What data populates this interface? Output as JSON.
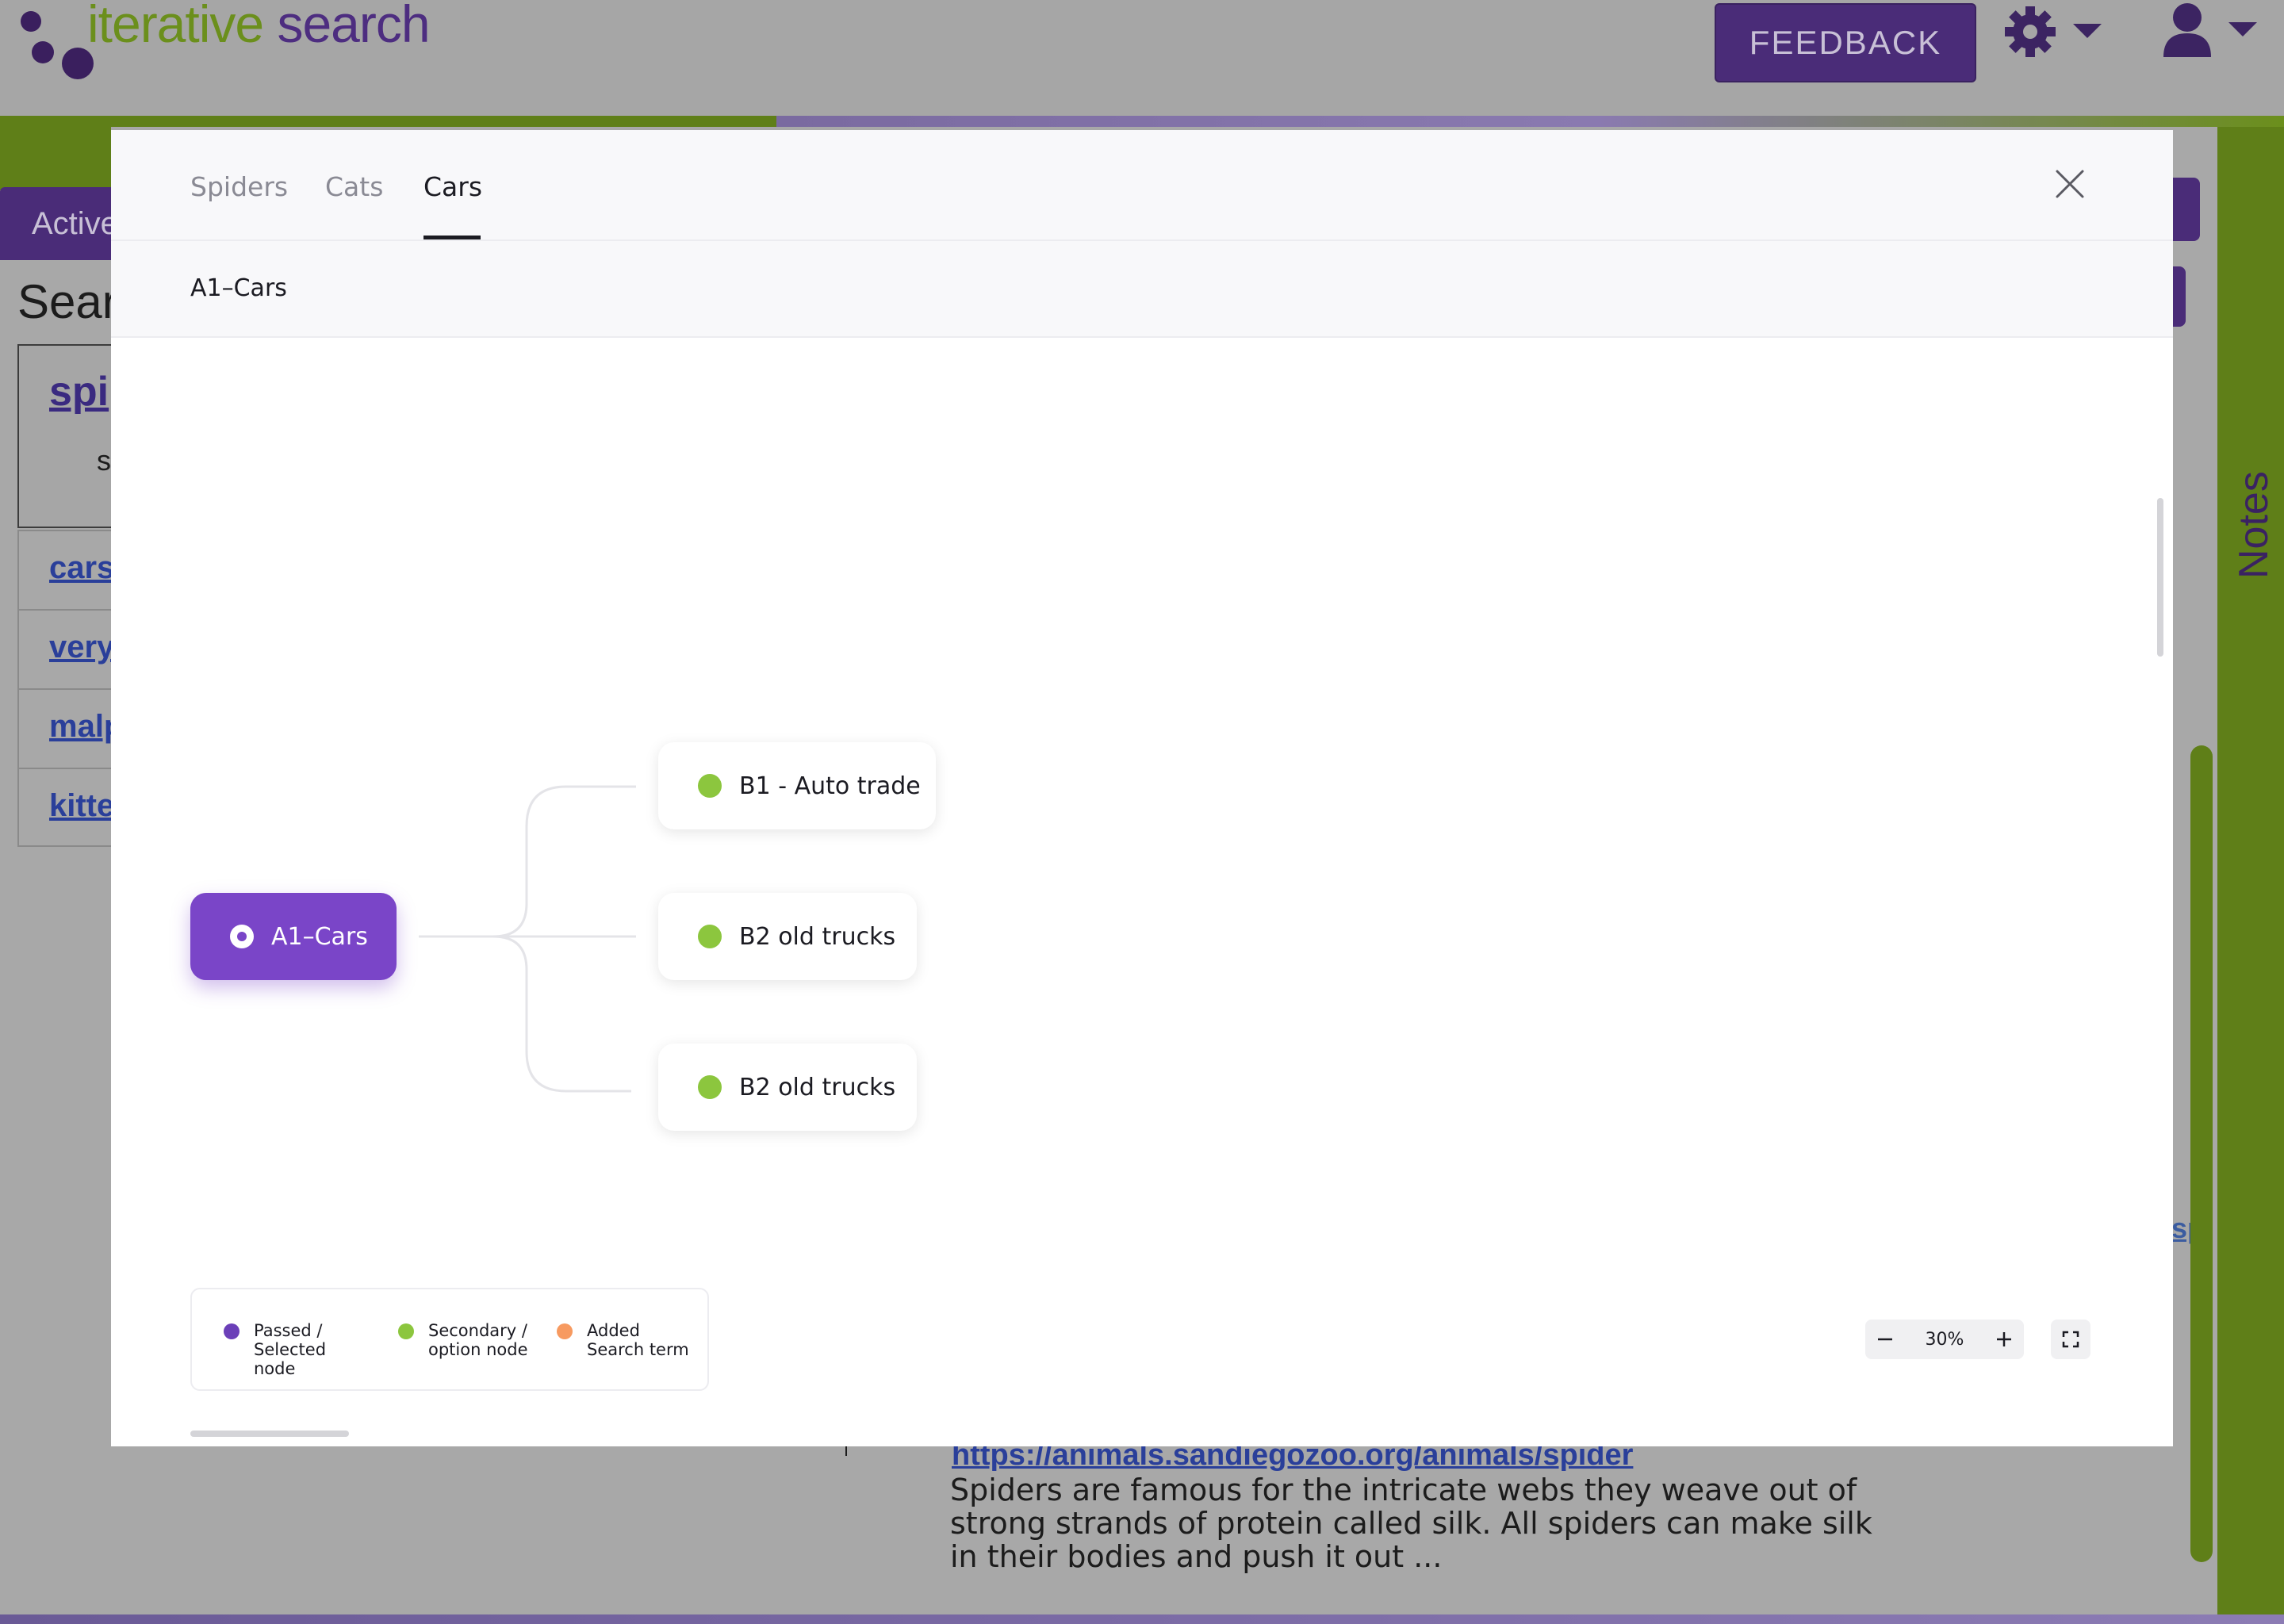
{
  "app": {
    "logo_prefix": "iterative",
    "logo_suffix": " search",
    "feedback_label": "FEEDBACK",
    "notes_label": "Notes",
    "active_tab_label": "Active",
    "search_heading": "Sear",
    "card_link": "spi",
    "card_text": "s",
    "list_items": [
      "cars",
      "very",
      "malp",
      "kitte"
    ],
    "right_link_fragment": "sp",
    "result_url": "https://animals.sandiegozoo.org/animals/spider",
    "result_snippet": "Spiders are famous for the intricate webs they weave out of strong strands of protein called silk. All spiders can make silk in their bodies and push it out ..."
  },
  "modal": {
    "tabs": [
      {
        "label": "Spiders",
        "active": false
      },
      {
        "label": "Cats",
        "active": false
      },
      {
        "label": "Cars",
        "active": true
      }
    ],
    "breadcrumb": "A1–Cars",
    "root_node": {
      "label": "A1–Cars",
      "color": "#7a45c8"
    },
    "child_nodes": [
      {
        "label": "B1 - Auto trade"
      },
      {
        "label": "B2 old trucks"
      },
      {
        "label": "B2 old trucks"
      }
    ],
    "legend": [
      {
        "label": "Passed / Selected node",
        "color": "#6b3fb8"
      },
      {
        "label": "Secondary / option node",
        "color": "#8cc63e"
      },
      {
        "label": "Added Search term",
        "color": "#f79a60"
      }
    ],
    "zoom_level": "30%",
    "icons": {
      "close": "close-icon",
      "zoom_out": "minus-icon",
      "zoom_in": "plus-icon",
      "fullscreen": "fullscreen-icon"
    }
  },
  "colors": {
    "brand_purple": "#4a2c78",
    "brand_green": "#5f7f18",
    "node_green": "#8cc63e",
    "accent_orange": "#f79a60"
  }
}
